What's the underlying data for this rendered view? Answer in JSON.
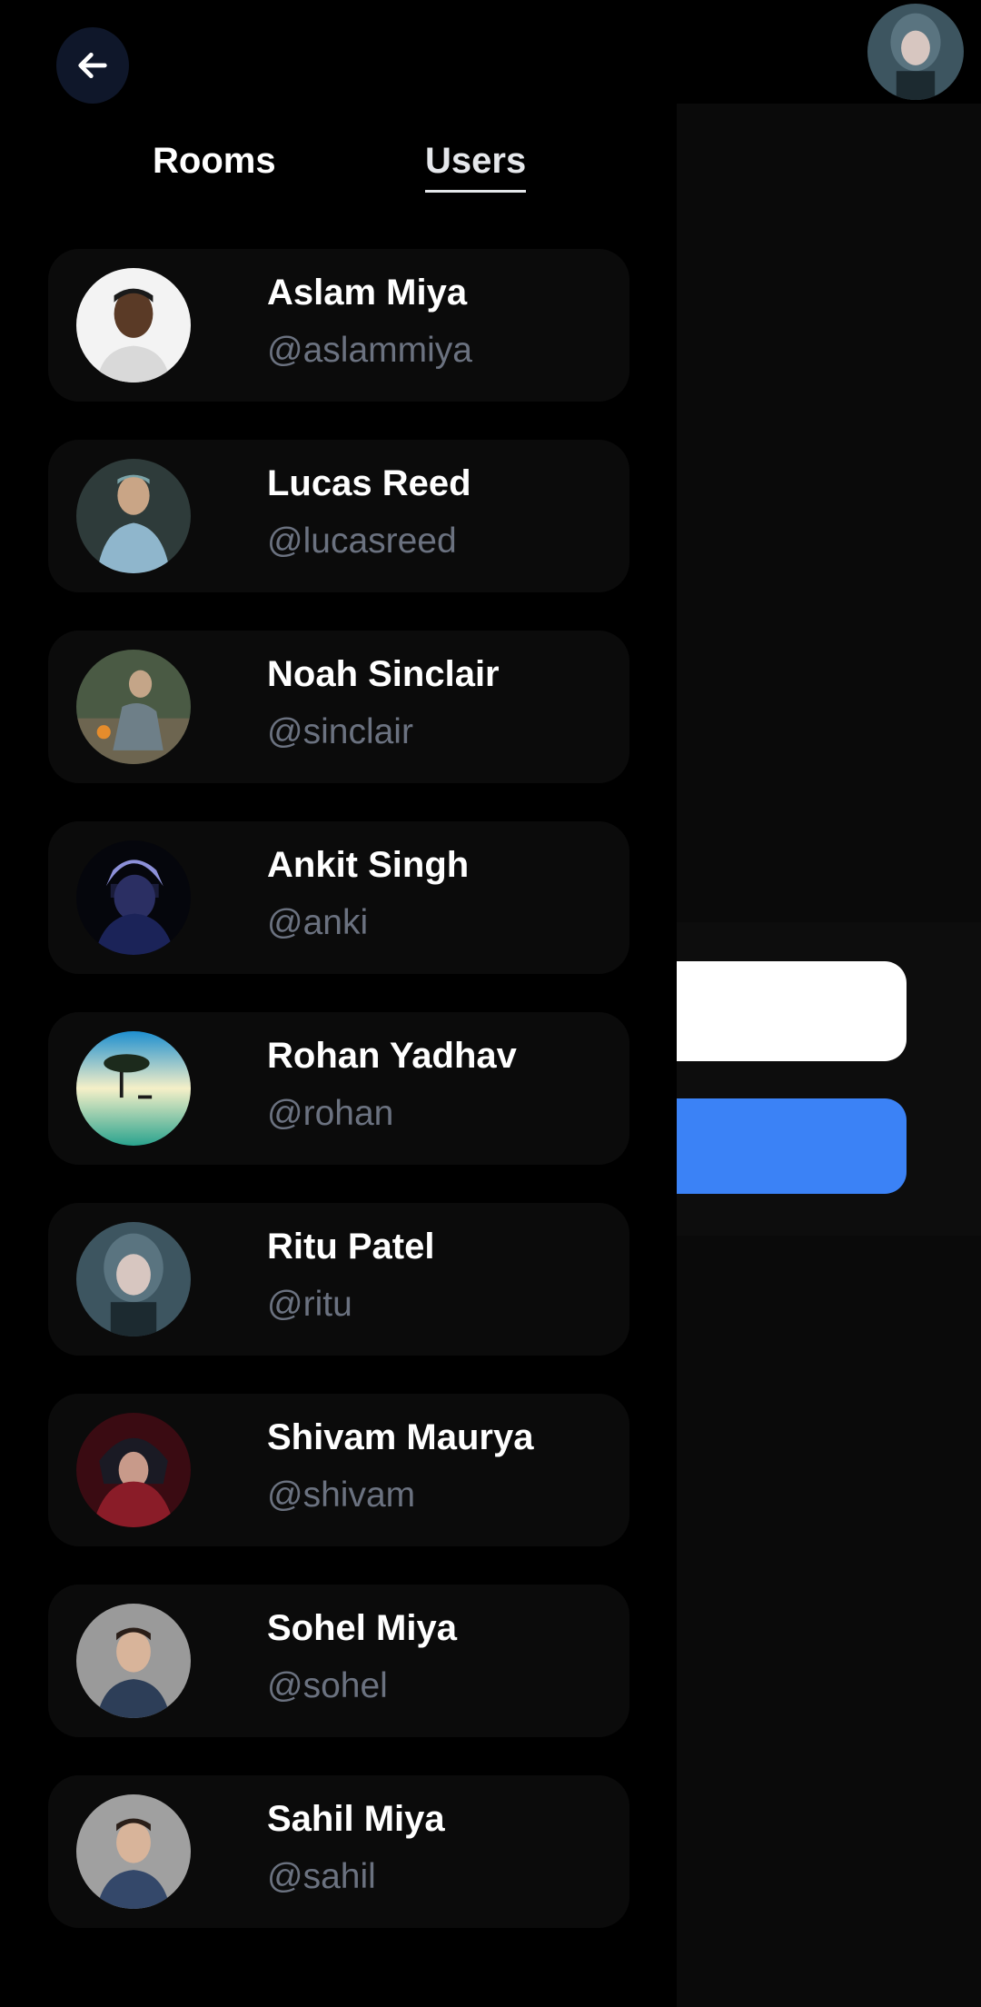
{
  "tabs": {
    "rooms": "Rooms",
    "users": "Users",
    "active": "Users"
  },
  "users": [
    {
      "name": "Aslam Miya",
      "handle": "@aslammiya"
    },
    {
      "name": "Lucas Reed",
      "handle": "@lucasreed"
    },
    {
      "name": "Noah Sinclair",
      "handle": "@sinclair"
    },
    {
      "name": "Ankit Singh",
      "handle": "@anki"
    },
    {
      "name": "Rohan Yadhav",
      "handle": "@rohan"
    },
    {
      "name": "Ritu Patel",
      "handle": "@ritu"
    },
    {
      "name": "Shivam Maurya",
      "handle": "@shivam"
    },
    {
      "name": "Sohel Miya",
      "handle": "@sohel"
    },
    {
      "name": "Sahil Miya",
      "handle": "@sahil"
    }
  ],
  "icons": {
    "back": "arrow-left-icon"
  },
  "colors": {
    "accent": "#3b82f6",
    "back_button_bg": "#0f172a",
    "handle_text": "#6b7280"
  }
}
